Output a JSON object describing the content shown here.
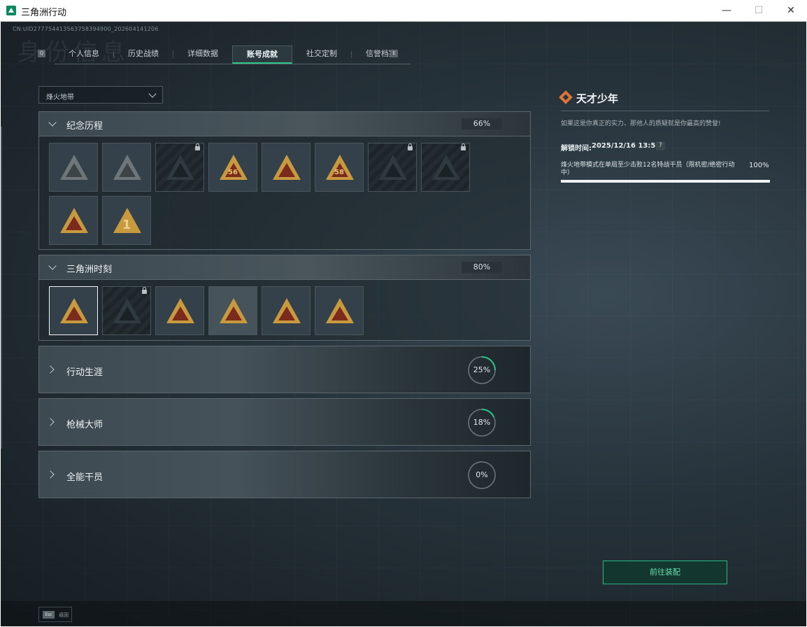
{
  "window": {
    "title": "三角洲行动",
    "minimize": "—",
    "maximize": "☐",
    "close": "✕"
  },
  "header": {
    "uid": "CN:UID277754413563758394900_202604141206",
    "bg_title": "身份信息"
  },
  "tabs": {
    "key_left": "Q",
    "key_right": "E",
    "items": [
      "个人信息",
      "历史战绩",
      "详细数据",
      "账号成就",
      "社交定制",
      "信誉档案"
    ],
    "active_index": 3
  },
  "mode_select": {
    "value": "烽火地带"
  },
  "sections": {
    "s1": {
      "title": "纪念历程",
      "percent": "66%",
      "badge_numbers": [
        "56",
        "58",
        "1"
      ]
    },
    "s2": {
      "title": "三角洲时刻",
      "percent": "80%"
    },
    "s3": {
      "title": "行动生涯",
      "percent": "25%",
      "progress": 0.25
    },
    "s4": {
      "title": "枪械大师",
      "percent": "18%",
      "progress": 0.18
    },
    "s5": {
      "title": "全能干员",
      "percent": "0%",
      "progress": 0
    }
  },
  "detail": {
    "title": "天才少年",
    "description": "如果这是你真正的实力、那他人的质疑就是你最高的赞誉!",
    "unlock_label": "解锁时间:",
    "unlock_time": "2025/12/16 13:51",
    "help": "?",
    "condition": "烽火地带模式在单局至少击败12名特战干员（限机密/绝密行动中）",
    "condition_percent": "100%",
    "condition_progress": 1.0
  },
  "actions": {
    "equip_label": "前往装配"
  },
  "footer": {
    "esc_key": "Esc",
    "esc_label": "返回"
  },
  "colors": {
    "accent": "#2ec489",
    "badge_gold": "#c79a3f",
    "badge_red": "#7b2a1c",
    "detail_icon": "#d9743a"
  }
}
